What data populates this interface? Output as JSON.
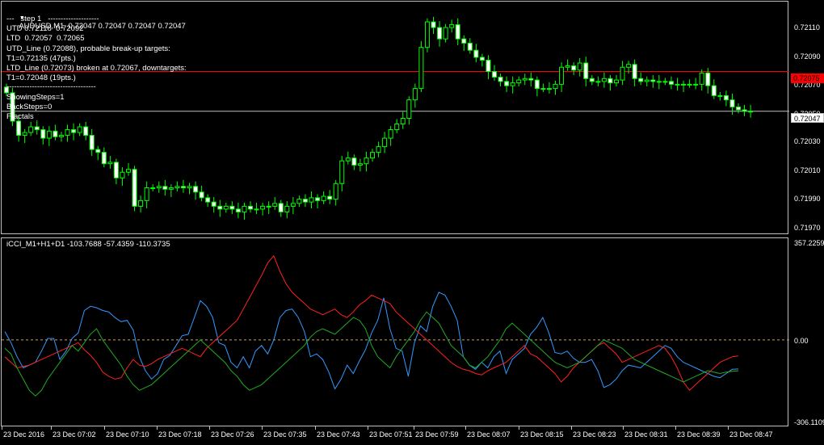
{
  "main_chart": {
    "symbol_line": "AUDUSD,M1  0.72047 0.72047 0.72047 0.72047",
    "annotations": [
      "---   step 1   --------------------",
      "UTD 0.72118  0.72092",
      "LTD  0.72057  0.72065",
      "UTD_Line (0.72088), probable break-up targets:",
      "T1=0.72135 (47pts.)",
      "LTD_Line (0.72073) broken at 0.72067, downtargets:",
      "T1=0.72048 (19pts.)",
      "-----------------------------------",
      "ShowingSteps=1",
      "BackSteps=0",
      "Fractals"
    ],
    "price_scale": [
      "0.72110",
      "0.72090",
      "0.72070",
      "0.72050",
      "0.72030",
      "0.72010",
      "0.71990",
      "0.71970"
    ],
    "red_line_price": "0.72075",
    "bid_price": "0.72047",
    "colors": {
      "bull": "#00ff00",
      "bear": "#ffffff",
      "red_line": "#ff0000",
      "bid_line": "#c0c0c0",
      "tag_red": "#ff0000",
      "tag_bid": "#c0c0c0"
    }
  },
  "indicator": {
    "caption": "iCCI_M1+H1+D1 -103.7688 -57.4359 -110.3735",
    "scale": [
      "357.2259",
      "0.00",
      "-306.1109"
    ],
    "colors": {
      "m1": "#3399ff",
      "h1": "#ff2020",
      "d1": "#22aa22",
      "zero": "#c8a060"
    }
  },
  "time_axis": [
    "23 Dec 2016",
    "23 Dec 07:02",
    "23 Dec 07:10",
    "23 Dec 07:18",
    "23 Dec 07:26",
    "23 Dec 07:35",
    "23 Dec 07:43",
    "23 Dec 07:51",
    "23 Dec 07:59",
    "23 Dec 08:07",
    "23 Dec 08:15",
    "23 Dec 08:23",
    "23 Dec 08:31",
    "23 Dec 08:39",
    "23 Dec 08:47"
  ],
  "chart_data": [
    {
      "type": "candlestick",
      "title": "AUDUSD,M1  0.72047 0.72047 0.72047 0.72047",
      "ylim": [
        0.71962,
        0.72122
      ],
      "close": [
        0.7206,
        0.7204,
        0.7203,
        0.72032,
        0.72036,
        0.72034,
        0.72028,
        0.72033,
        0.72029,
        0.7203,
        0.72034,
        0.72032,
        0.72036,
        0.7203,
        0.7202,
        0.72018,
        0.7201,
        0.72011,
        0.72,
        0.72004,
        0.72006,
        0.7198,
        0.71984,
        0.71993,
        0.71993,
        0.71994,
        0.71992,
        0.71993,
        0.71994,
        0.71993,
        0.71994,
        0.7199,
        0.71986,
        0.71983,
        0.7198,
        0.71978,
        0.7198,
        0.71978,
        0.71976,
        0.7198,
        0.71978,
        0.71978,
        0.7198,
        0.7198,
        0.71982,
        0.71976,
        0.7198,
        0.71982,
        0.71985,
        0.71983,
        0.71986,
        0.71984,
        0.71987,
        0.71985,
        0.71996,
        0.72012,
        0.72014,
        0.72009,
        0.7201,
        0.72014,
        0.72018,
        0.72022,
        0.72028,
        0.72034,
        0.72038,
        0.72042,
        0.72055,
        0.72063,
        0.72092,
        0.7211,
        0.72106,
        0.72098,
        0.72106,
        0.72108,
        0.72098,
        0.72095,
        0.7209,
        0.72085,
        0.72083,
        0.72075,
        0.72071,
        0.72068,
        0.72065,
        0.72067,
        0.72069,
        0.7207,
        0.72069,
        0.72063,
        0.72063,
        0.72063,
        0.72066,
        0.72078,
        0.72079,
        0.72076,
        0.72081,
        0.7207,
        0.72068,
        0.72068,
        0.7207,
        0.72067,
        0.72069,
        0.72078,
        0.7208,
        0.7207,
        0.72068,
        0.72069,
        0.72068,
        0.72068,
        0.72068,
        0.72066,
        0.72066,
        0.72066,
        0.72066,
        0.72066,
        0.72074,
        0.72065,
        0.72058,
        0.72058,
        0.72055,
        0.7205,
        0.72048,
        0.72047,
        0.72047
      ]
    },
    {
      "type": "line",
      "title": "iCCI_M1+H1+D1 -103.7688 -57.4359 -110.3735",
      "ylim": [
        -306.1109,
        357.2259
      ],
      "series": [
        {
          "name": "M1",
          "values": [
            30,
            -10,
            -60,
            -100,
            -90,
            -80,
            -40,
            5,
            5,
            -70,
            -40,
            5,
            25,
            105,
            120,
            115,
            105,
            100,
            80,
            65,
            70,
            35,
            -60,
            -110,
            -140,
            -120,
            -70,
            -55,
            -20,
            15,
            20,
            80,
            140,
            120,
            80,
            -10,
            -20,
            -80,
            -100,
            -60,
            -100,
            -40,
            -20,
            -50,
            0,
            80,
            105,
            110,
            80,
            30,
            -60,
            -50,
            -70,
            -115,
            -175,
            -140,
            -90,
            -120,
            -75,
            -35,
            25,
            70,
            150,
            40,
            -30,
            -40,
            -130,
            -10,
            50,
            30,
            120,
            170,
            160,
            120,
            70,
            -60,
            -90,
            -105,
            -80,
            -100,
            -60,
            -40,
            -120,
            -70,
            -50,
            -30,
            20,
            45,
            80,
            25,
            -45,
            -50,
            -40,
            -65,
            -80,
            -80,
            -70,
            -110,
            -170,
            -160,
            -140,
            -110,
            -90,
            -95,
            -100,
            -80,
            -60,
            -40,
            -20,
            -30,
            -60,
            -80,
            -90,
            -100,
            -110,
            -120,
            -130,
            -135,
            -120,
            -105,
            -103.8
          ]
        },
        {
          "name": "H1",
          "values": [
            -60,
            -80,
            -100,
            -95,
            -90,
            -80,
            -70,
            -60,
            -50,
            -40,
            -30,
            -20,
            -10,
            -35,
            -55,
            -80,
            -115,
            -130,
            -140,
            -135,
            -100,
            -70,
            -90,
            -95,
            -85,
            -70,
            -60,
            -50,
            -40,
            -30,
            -40,
            -50,
            -60,
            -30,
            -10,
            10,
            30,
            50,
            70,
            110,
            150,
            190,
            230,
            275,
            300,
            245,
            200,
            170,
            150,
            130,
            110,
            100,
            90,
            100,
            110,
            90,
            80,
            100,
            125,
            140,
            160,
            150,
            140,
            130,
            100,
            80,
            60,
            40,
            20,
            0,
            -20,
            -40,
            -60,
            -80,
            -95,
            -105,
            -110,
            -120,
            -125,
            -110,
            -100,
            -90,
            -80,
            -60,
            -40,
            -20,
            -50,
            -60,
            -80,
            -100,
            -120,
            -150,
            -130,
            -100,
            -80,
            -60,
            -40,
            -20,
            -10,
            -30,
            -50,
            -80,
            -70,
            -60,
            -50,
            -40,
            -30,
            -20,
            -30,
            -60,
            -100,
            -150,
            -180,
            -160,
            -140,
            -120,
            -100,
            -80,
            -70,
            -60,
            -57.4
          ]
        },
        {
          "name": "D1",
          "values": [
            -30,
            -50,
            -100,
            -140,
            -180,
            -200,
            -180,
            -140,
            -110,
            -80,
            -50,
            -20,
            -40,
            -10,
            20,
            40,
            0,
            -30,
            -60,
            -90,
            -130,
            -160,
            -180,
            -170,
            -160,
            -140,
            -120,
            -100,
            -80,
            -60,
            -40,
            -20,
            0,
            -20,
            -40,
            -60,
            -80,
            -110,
            -130,
            -160,
            -180,
            -170,
            -160,
            -140,
            -120,
            -100,
            -80,
            -60,
            -40,
            -20,
            10,
            30,
            40,
            30,
            20,
            40,
            60,
            80,
            70,
            40,
            -20,
            -60,
            -80,
            -100,
            -60,
            -30,
            0,
            30,
            70,
            100,
            80,
            60,
            20,
            -20,
            -40,
            -60,
            -90,
            -100,
            -80,
            -60,
            -30,
            0,
            40,
            60,
            40,
            20,
            0,
            -20,
            -40,
            -60,
            -80,
            -90,
            -100,
            -90,
            -80,
            -60,
            -40,
            -20,
            0,
            -10,
            -20,
            -30,
            -50,
            -70,
            -80,
            -90,
            -100,
            -110,
            -120,
            -130,
            -140,
            -150,
            -140,
            -130,
            -120,
            -110,
            -115,
            -120,
            -115,
            -112,
            -110.4
          ]
        }
      ]
    }
  ]
}
